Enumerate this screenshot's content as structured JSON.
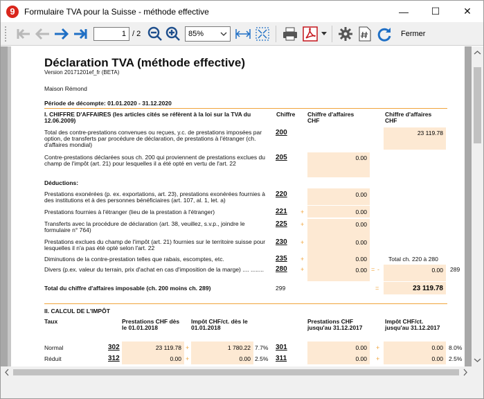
{
  "window": {
    "title": "Formulaire TVA pour la Suisse - méthode effective",
    "app_icon": "9",
    "minimize": "—",
    "maximize": "☐",
    "close": "✕"
  },
  "toolbar": {
    "page": "1",
    "page_total": "/ 2",
    "zoom": "85%",
    "close_label": "Fermer"
  },
  "doc": {
    "title": "Déclaration TVA (méthode effective)",
    "version": "Version 20171201ef_fr (BETA)",
    "company": "Maison Rémond",
    "period": "Période de décompte: 01.01.2020 - 31.12.2020",
    "s1_title": "I. CHIFFRE D'AFFAIRES (les articles cités se réfèrent à la loi sur la TVA du 12.06.2009)",
    "col_chiffre": "Chiffre",
    "col_ca1": "Chiffre d'affaires CHF",
    "col_ca2": "Chiffre d'affaires CHF",
    "rows": [
      {
        "label": "Total des contre-prestations convenues ou reçues, y.c. de prestations imposées par option, de transferts par procédure de déclaration, de prestations à l'étranger (ch. d'affaires mondial)",
        "code": "200",
        "value": "23 119.78"
      },
      {
        "label": "Contre-prestations déclarées sous ch. 200 qui proviennent de prestations exclues du champ de l'impôt (art. 21) pour lesquelles il a été opté en vertu de l'art. 22",
        "code": "205",
        "value": "0.00"
      },
      {
        "label": "Déductions:"
      },
      {
        "label": "Prestations exonérées (p. ex. exportations, art. 23), prestations exonérées fournies à des institutions et à des personnes bénéficiaires (art. 107, al. 1, let. a)",
        "code": "220",
        "value": "0.00"
      },
      {
        "label": "Prestations fournies à l'étranger (lieu de la prestation à l'étranger)",
        "code": "221",
        "plus": "+",
        "value": "0.00"
      },
      {
        "label": "Transferts avec la procédure de déclaration (art. 38, veuillez, s.v.p., joindre le formulaire n° 764)",
        "code": "225",
        "plus": "+",
        "value": "0.00"
      },
      {
        "label": "Prestations exclues du champ de l'impôt (art. 21) fournies sur le territoire suisse pour lesquelles il n'a pas été opté selon l'art. 22",
        "code": "230",
        "plus": "+",
        "value": "0.00"
      },
      {
        "label": "Diminutions de la contre-prestation telles que rabais, escomptes, etc.",
        "code": "235",
        "plus": "+",
        "value": "0.00",
        "extra": "Total ch. 220 à 280"
      },
      {
        "label": "Divers (p.ex. valeur du terrain, prix d'achat en cas d'imposition de la marge) .... ........",
        "code": "280",
        "plus": "+",
        "value": "0.00",
        "eq": "=",
        "minus": "-",
        "value2": "0.00",
        "code2": "289"
      }
    ],
    "total_label": "Total du chiffre d'affaires imposable (ch. 200 moins ch. 289)",
    "total_code": "299",
    "total_eq": "=",
    "total_value": "23 119.78",
    "s2_title": "II. CALCUL DE L'IMPÔT",
    "s2_cols": {
      "taux": "Taux",
      "prest1": "Prestations CHF dès le 01.01.2018",
      "impot1": "Impôt CHF/ct. dès le 01.01.2018",
      "prest2": "Prestations CHF jusqu'au 31.12.2017",
      "impot2": "Impôt CHF/ct. jusqu'au 31.12.2017"
    },
    "s2_rows": [
      {
        "label": "Normal",
        "code": "302",
        "prest1": "23 119.78",
        "plus1": "+",
        "impot1": "1 780.22",
        "rate1": "7.7%",
        "code2": "301",
        "prest2": "0.00",
        "plus2": "+",
        "impot2": "0.00",
        "rate2": "8.0%"
      },
      {
        "label": "Réduit",
        "code": "312",
        "prest1": "0.00",
        "plus1": "+",
        "impot1": "0.00",
        "rate1": "2.5%",
        "code2": "311",
        "prest2": "0.00",
        "plus2": "+",
        "impot2": "0.00",
        "rate2": "2.5%"
      }
    ]
  }
}
